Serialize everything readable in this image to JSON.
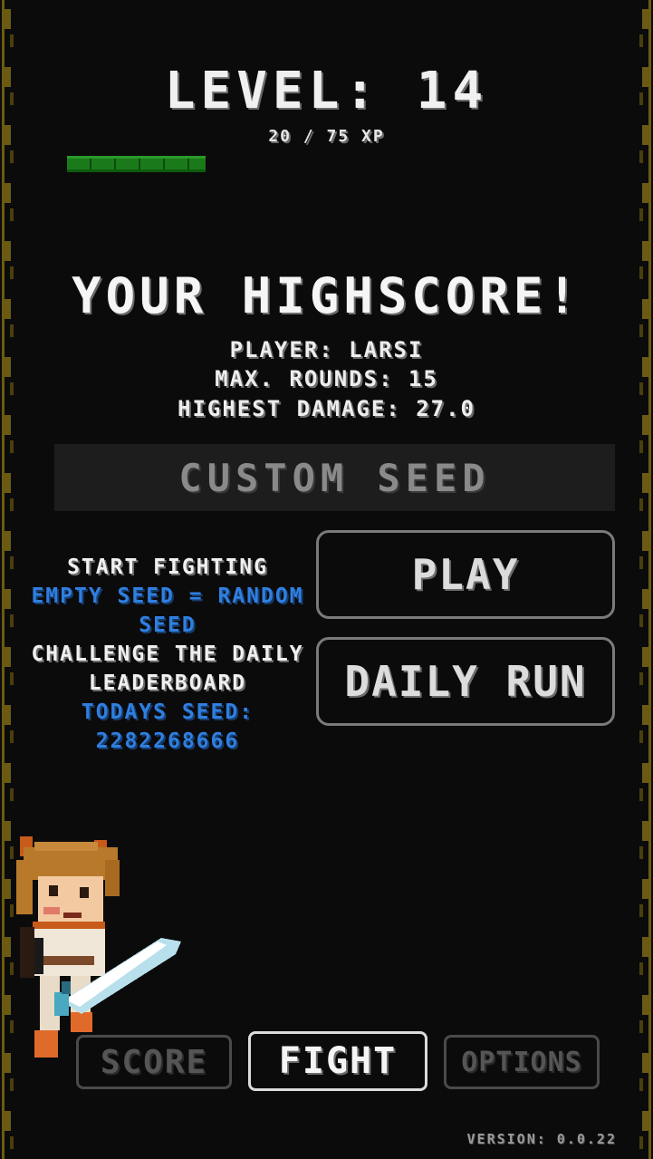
{
  "level": {
    "title": "LEVEL: 14",
    "xp_text": "20 / 75 XP",
    "xp_current": 20,
    "xp_max": 75
  },
  "highscore": {
    "title": "YOUR HIGHSCORE!",
    "player": "PLAYER: LARSI",
    "rounds": "MAX. ROUNDS: 15",
    "damage": "HIGHEST DAMAGE: 27.0"
  },
  "seed_input": {
    "placeholder": "CUSTOM SEED",
    "value": ""
  },
  "info": {
    "play_hint": "START FIGHTING",
    "play_seed_hint": "EMPTY SEED = RANDOM SEED",
    "daily_hint": "CHALLENGE THE DAILY LEADERBOARD",
    "todays_seed_label": "TODAYS SEED:",
    "todays_seed_value": "2282268666"
  },
  "buttons": {
    "play": "PLAY",
    "daily_run": "DAILY RUN"
  },
  "nav": {
    "score": "SCORE",
    "fight": "FIGHT",
    "options": "OPTIONS",
    "active": "FIGHT"
  },
  "version": "VERSION: 0.0.22",
  "colors": {
    "background": "#0b0b0b",
    "xp_green": "#1a7a1a",
    "accent_blue": "#2f7fe0",
    "border_gold": "#6b5a12"
  },
  "icons": {
    "character": "pixel-warrior-sprite"
  }
}
